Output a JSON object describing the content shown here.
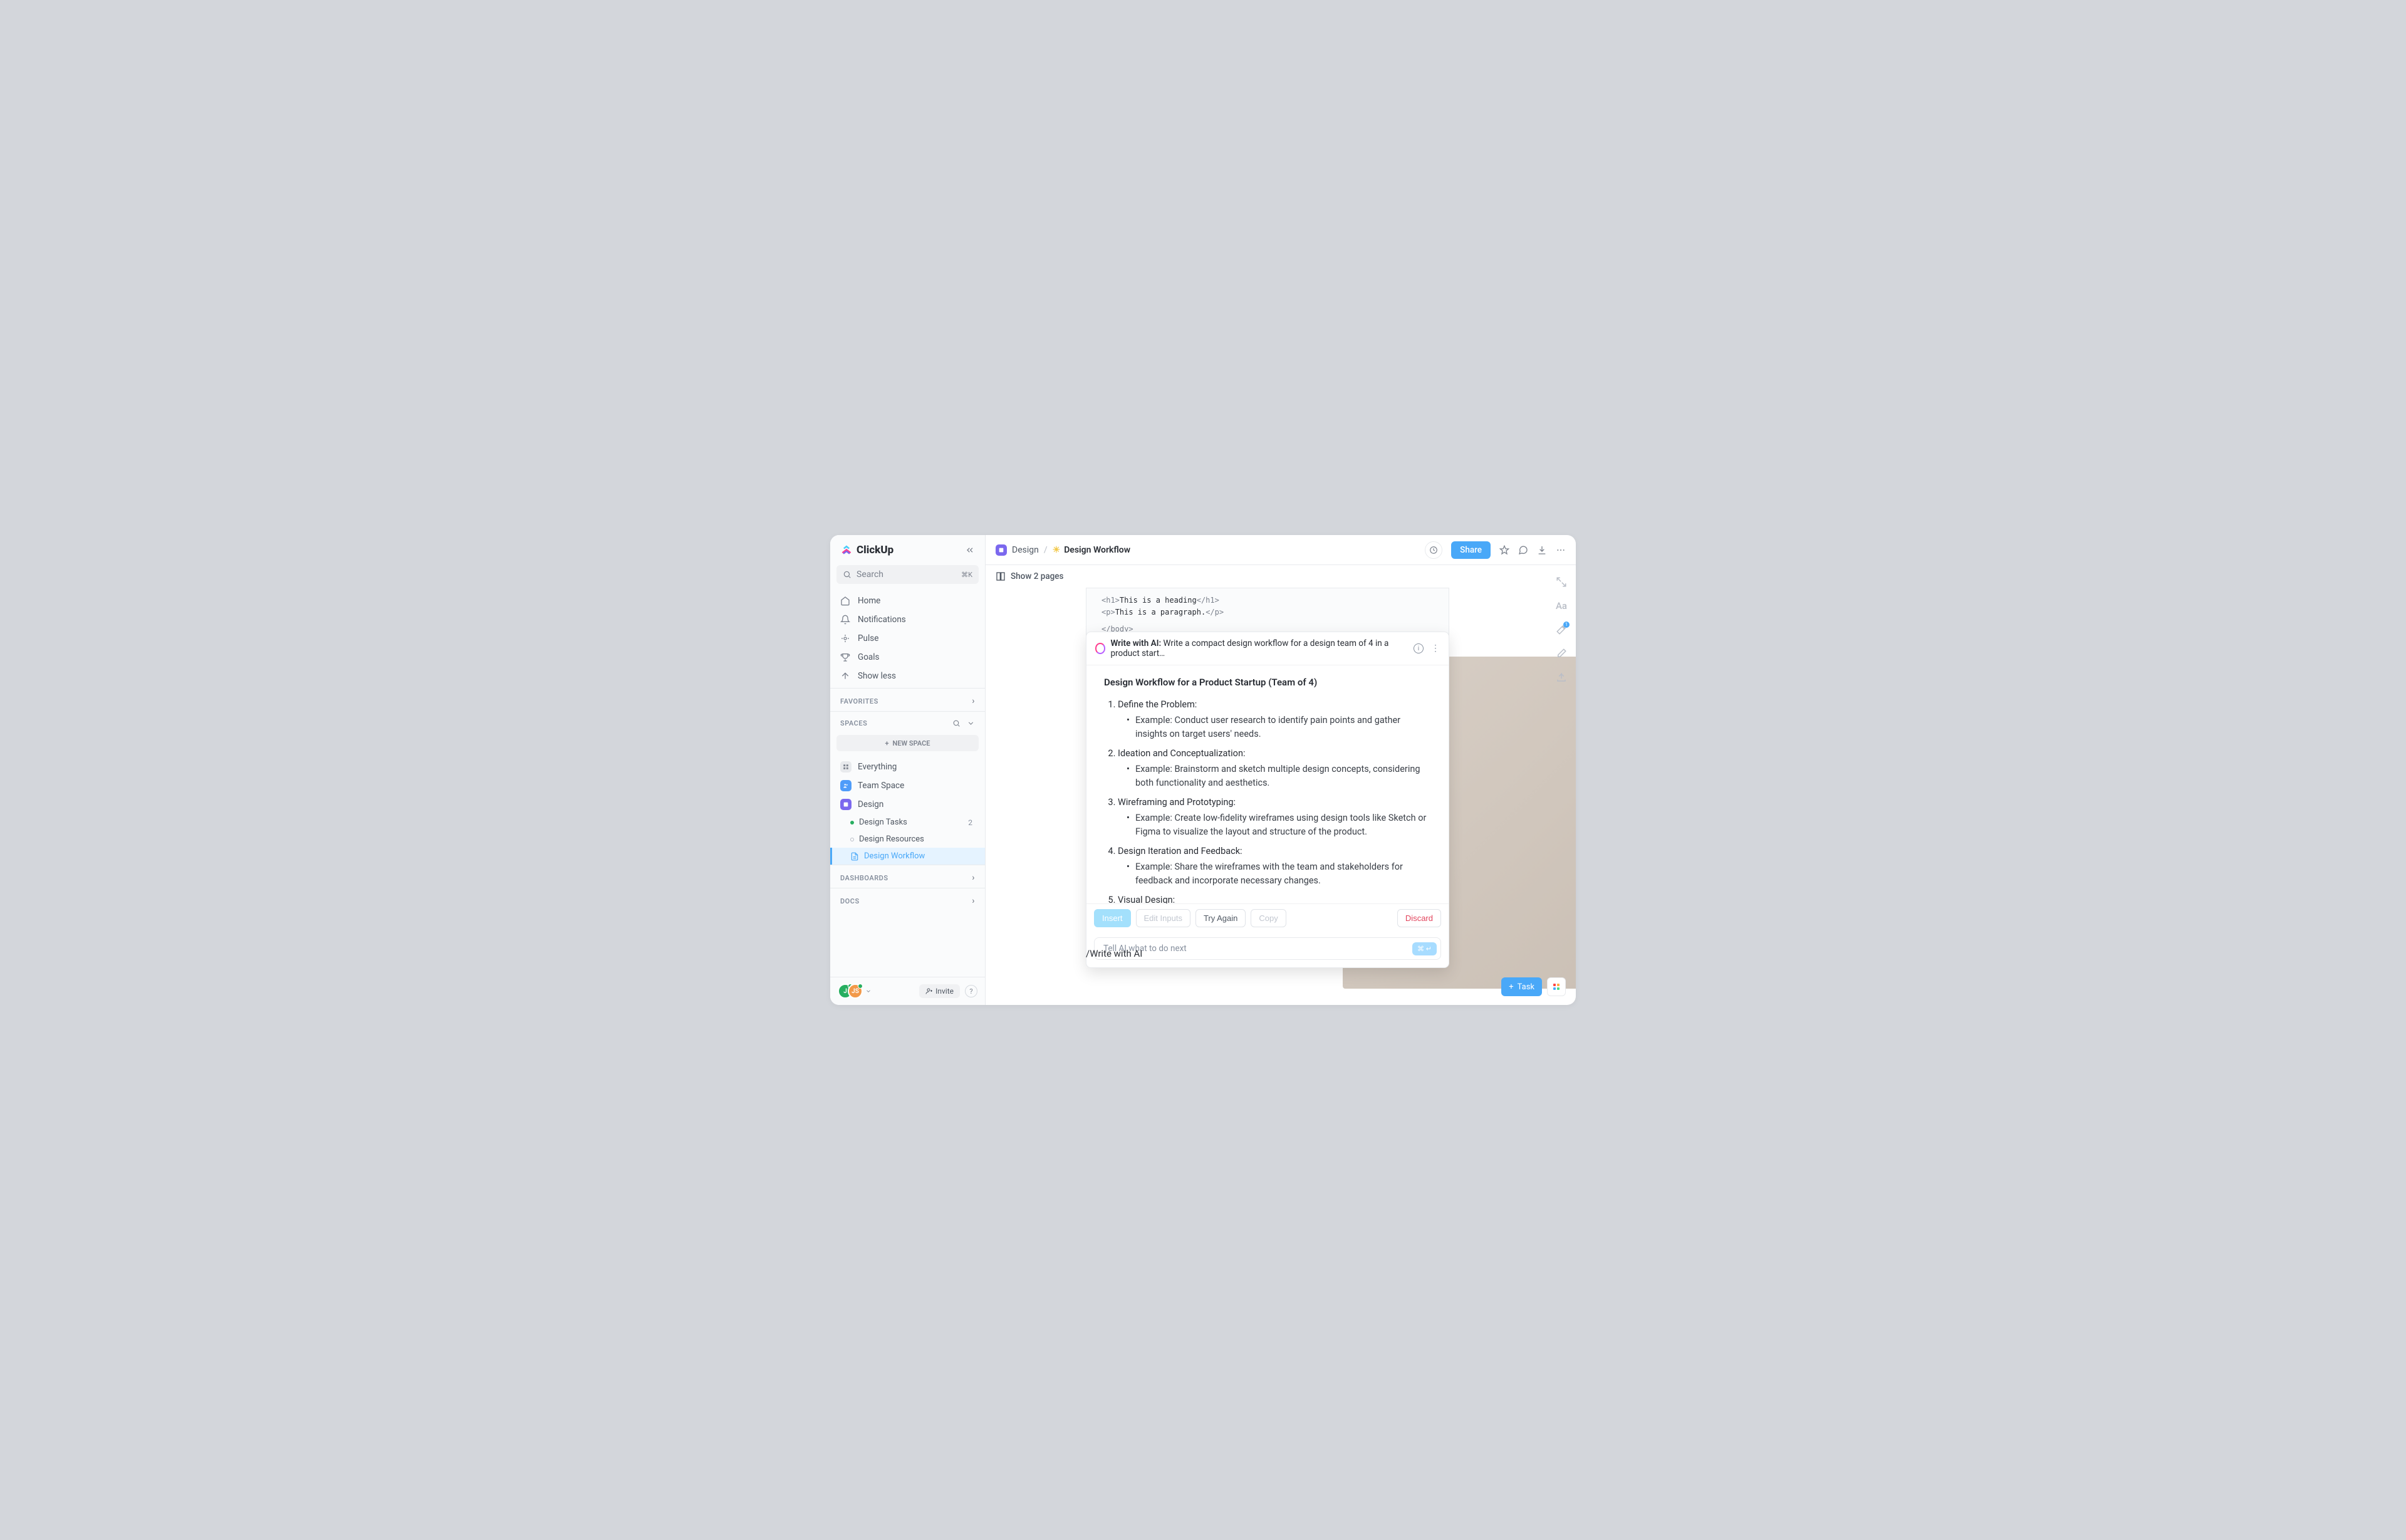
{
  "brand": "ClickUp",
  "search": {
    "placeholder": "Search",
    "kbd": "⌘K"
  },
  "nav": {
    "home": "Home",
    "notifications": "Notifications",
    "pulse": "Pulse",
    "goals": "Goals",
    "showless": "Show less"
  },
  "favorites": {
    "title": "FAVORITES"
  },
  "spaces": {
    "title": "SPACES",
    "new": "NEW SPACE",
    "everything": "Everything",
    "team": "Team Space",
    "design": "Design",
    "children": {
      "tasks": {
        "label": "Design Tasks",
        "count": "2"
      },
      "resources": {
        "label": "Design Resources"
      },
      "workflow": {
        "label": "Design Workflow"
      }
    }
  },
  "dashboards": {
    "title": "DASHBOARDS"
  },
  "docs": {
    "title": "DOCS"
  },
  "footer": {
    "invite": "Invite",
    "avatars": {
      "a": "J",
      "b": "JS"
    }
  },
  "breadcrumb": {
    "parent": "Design",
    "sep": "/",
    "current": "Design Workflow",
    "sun": "☀"
  },
  "topbar": {
    "share": "Share"
  },
  "subtoolbar": {
    "showpages": "Show 2 pages"
  },
  "code": {
    "line1": {
      "open": "<h1>",
      "text": "This is a heading",
      "close": "</h1>"
    },
    "line2": {
      "open": "<p>",
      "text": "This is a paragraph.",
      "close": "</p>"
    },
    "line3": "</body>"
  },
  "ai": {
    "label": "Write with AI:",
    "prompt": "Write a compact design workflow for a design team of 4 in a product start…",
    "doc_title": "Design Workflow for a Product Startup (Team of 4)",
    "items": [
      {
        "title": "Define the Problem:",
        "example": "Example: Conduct user research to identify pain points and gather insights on target users' needs."
      },
      {
        "title": "Ideation and Conceptualization:",
        "example": "Example: Brainstorm and sketch multiple design concepts, considering both functionality and aesthetics."
      },
      {
        "title": "Wireframing and Prototyping:",
        "example": "Example: Create low-fidelity wireframes using design tools like Sketch or Figma to visualize the layout and structure of the product."
      },
      {
        "title": "Design Iteration and Feedback:",
        "example": "Example: Share the wireframes with the team and stakeholders for feedback and incorporate necessary changes."
      },
      {
        "title": "Visual Design:"
      }
    ],
    "actions": {
      "insert": "Insert",
      "edit": "Edit Inputs",
      "tryagain": "Try Again",
      "copy": "Copy",
      "discard": "Discard"
    },
    "input_placeholder": "Tell AI what to do next",
    "send_kbd": "⌘ ↵"
  },
  "slash": "/Write with AI",
  "rail": {
    "typography": "Aa",
    "badge": "1"
  },
  "bottom": {
    "task": "Task"
  }
}
